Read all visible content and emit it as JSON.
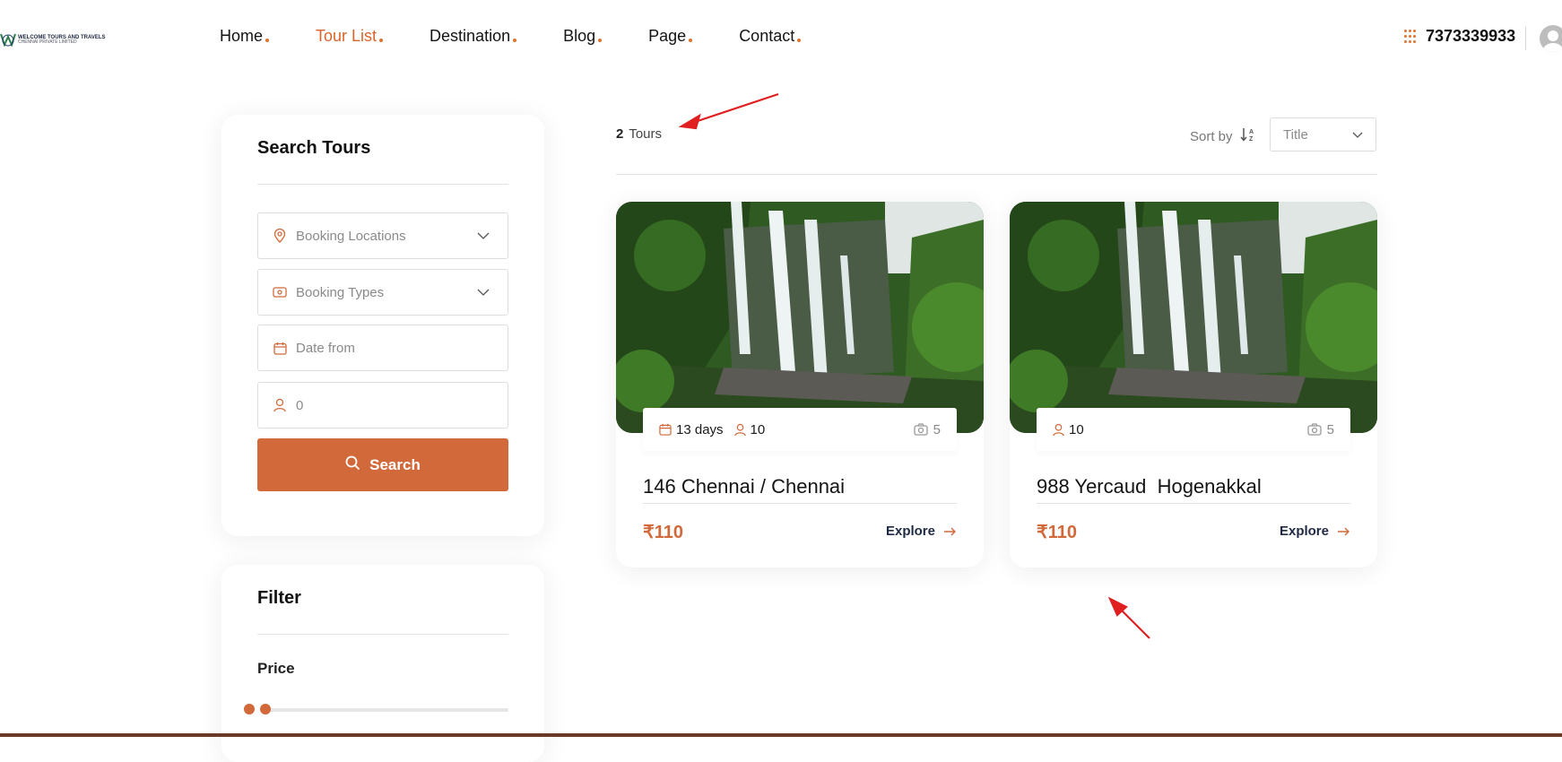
{
  "brand": {
    "name": "WELCOME TOURS AND TRAVELS",
    "sub": "CHENNAI PRIVATE LIMITED"
  },
  "nav": {
    "items": [
      {
        "label": "Home",
        "active": false
      },
      {
        "label": "Tour List",
        "active": true
      },
      {
        "label": "Destination",
        "active": false
      },
      {
        "label": "Blog",
        "active": false
      },
      {
        "label": "Page",
        "active": false
      },
      {
        "label": "Contact",
        "active": false
      }
    ],
    "phone": "7373339933"
  },
  "search": {
    "title": "Search Tours",
    "booking_locations": "Booking Locations",
    "booking_types": "Booking Types",
    "date_from": "Date from",
    "guests": "0",
    "button": "Search"
  },
  "filter": {
    "title": "Filter",
    "price_label": "Price"
  },
  "results": {
    "count": "2",
    "count_label": "Tours",
    "sort_label": "Sort by",
    "sort_value": "Title"
  },
  "tours": [
    {
      "days": "13 days",
      "people": "10",
      "photos": "5",
      "title": "146 Chennai / Chennai",
      "price": "₹110",
      "explore": "Explore"
    },
    {
      "people": "10",
      "photos": "5",
      "title": "988 Yercaud  Hogenakkal",
      "price": "₹110",
      "explore": "Explore"
    }
  ],
  "colors": {
    "accent": "#d2693a",
    "annotation": "#e02020"
  }
}
